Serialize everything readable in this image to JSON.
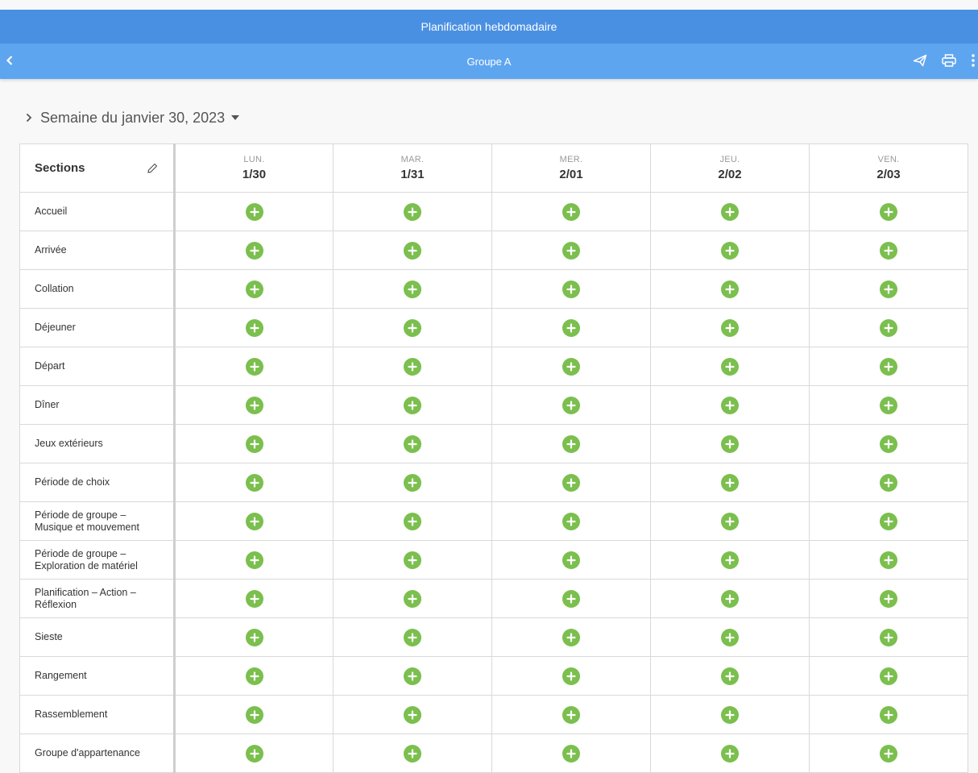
{
  "app": {
    "title": "Planification hebdomadaire",
    "group": "Groupe A"
  },
  "icons": {
    "back": "chevron-left-icon",
    "send": "send-icon",
    "print": "print-icon",
    "more": "more-vertical-icon",
    "edit": "pencil-icon",
    "add": "plus-circle-icon"
  },
  "colors": {
    "header": "#4a90e2",
    "subheader": "#5ea5f0",
    "add_button": "#7bbf4e"
  },
  "week": {
    "label": "Semaine du janvier 30, 2023"
  },
  "table": {
    "sections_header": "Sections",
    "days": [
      {
        "name": "LUN.",
        "date": "1/30"
      },
      {
        "name": "MAR.",
        "date": "1/31"
      },
      {
        "name": "MER.",
        "date": "2/01"
      },
      {
        "name": "JEU.",
        "date": "2/02"
      },
      {
        "name": "VEN.",
        "date": "2/03"
      }
    ],
    "sections": [
      "Accueil",
      "Arrivée",
      "Collation",
      "Déjeuner",
      "Départ",
      "Dîner",
      "Jeux extérieurs",
      "Période de choix",
      "Période de groupe – Musique et mouvement",
      "Période de groupe – Exploration de matériel",
      "Planification – Action – Réflexion",
      "Sieste",
      "Rangement",
      "Rassemblement",
      "Groupe d'appartenance"
    ]
  }
}
